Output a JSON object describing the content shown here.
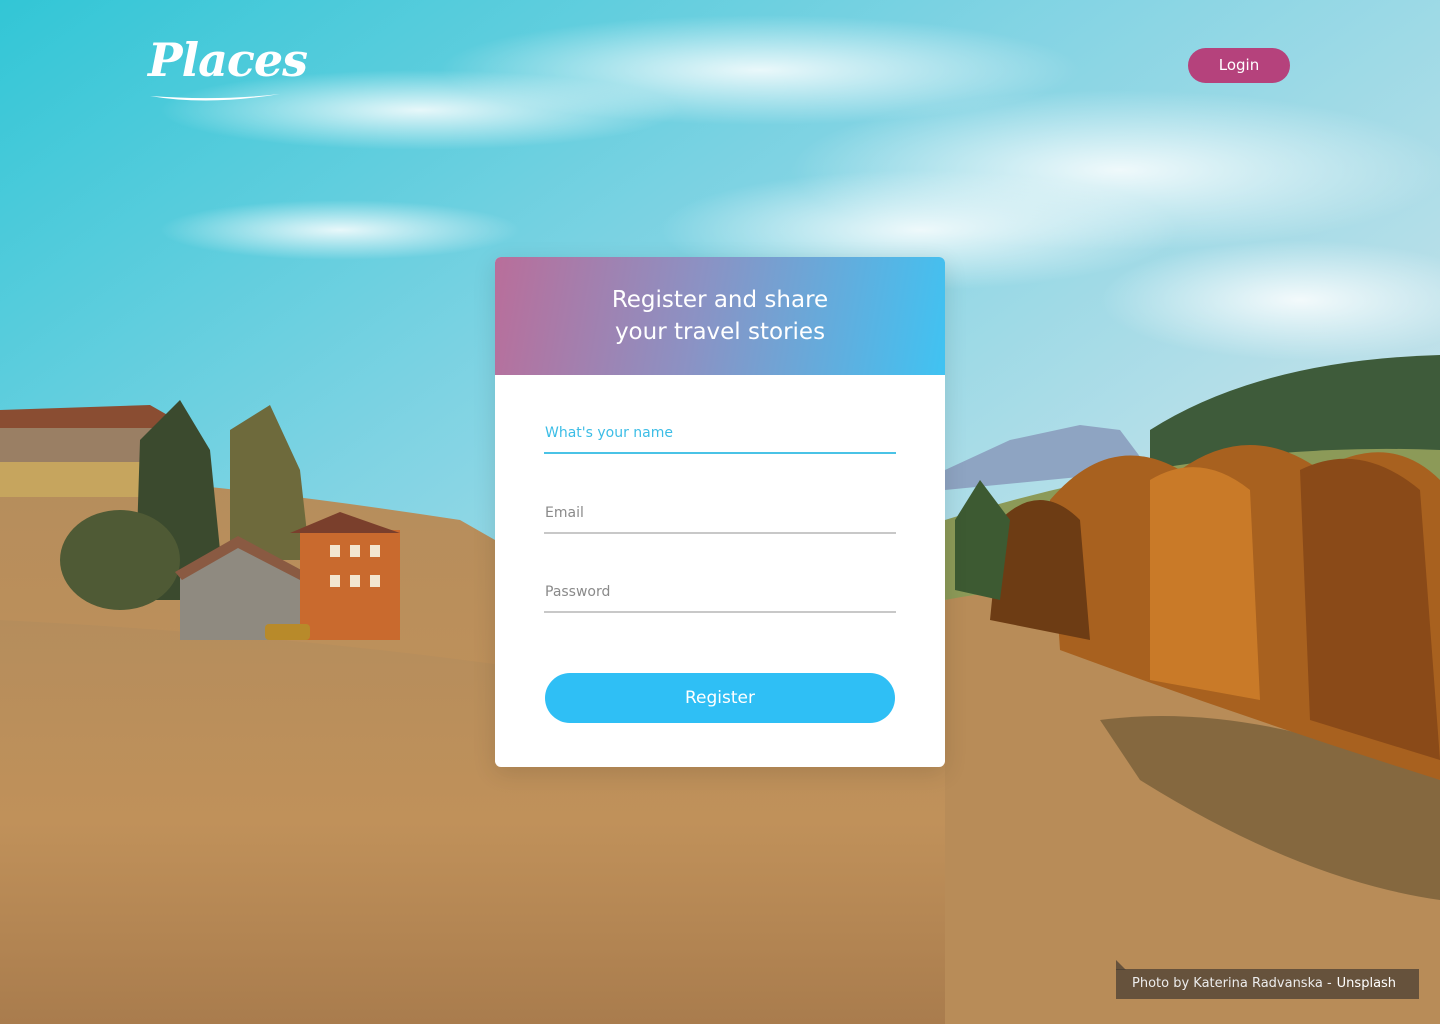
{
  "brand": {
    "logo_text": "Places"
  },
  "header": {
    "login_label": "Login"
  },
  "card": {
    "title_line1": "Register and share",
    "title_line2": "your travel stories"
  },
  "form": {
    "name_placeholder": "What's your name",
    "email_placeholder": "Email",
    "password_placeholder": "Password",
    "register_label": "Register"
  },
  "credit": {
    "text": "Photo by Katerina Radvanska -",
    "link": "Unsplash"
  },
  "colors": {
    "login_button": "#b5427c",
    "register_button": "#2fbff5",
    "active_underline": "#4ac3e6",
    "header_gradient_start": "#b96e9a",
    "header_gradient_end": "#40c3f2"
  }
}
